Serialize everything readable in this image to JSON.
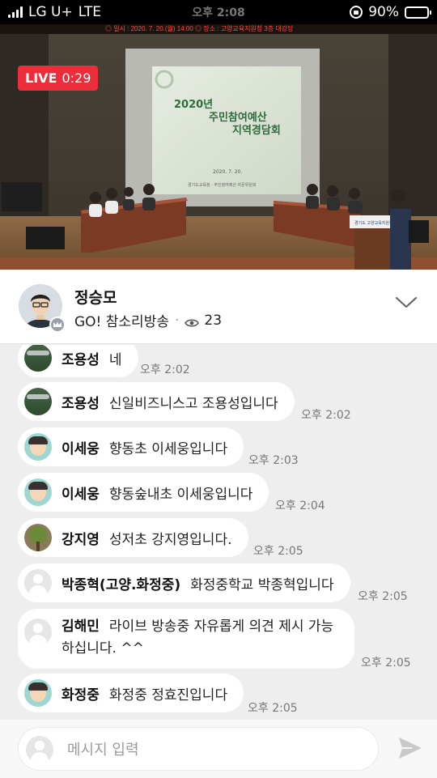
{
  "status_bar": {
    "carrier": "LG U+",
    "network": "LTE",
    "time": "오후 2:08",
    "battery": "90%",
    "battery_level": 0.9
  },
  "video": {
    "live_label": "LIVE",
    "elapsed": "0:29",
    "banner_text": "◎ 일시 : 2020. 7. 20.(월) 14:00   ◎ 장소 : 고양교육지원청 3층 대강당",
    "screen_title_1": "2020년",
    "screen_title_2": "주민참여예산",
    "screen_title_3": "지역경담회",
    "screen_date": "2020. 7. 20.",
    "screen_footer": "경기도교육청 · 주민참여예산 자문위원회",
    "podium_text": "경기도 고양교육지원청"
  },
  "profile": {
    "name": "정승모",
    "channel": "GO! 참소리방송",
    "separator": "·",
    "viewer_count": "23"
  },
  "messages": [
    {
      "name": "조용성",
      "text": "네",
      "time": "오후 2:02",
      "avatar": "ava-field"
    },
    {
      "name": "조용성",
      "text": "신일비즈니스고 조용성입니다",
      "time": "오후 2:02",
      "avatar": "ava-field"
    },
    {
      "name": "이세웅",
      "text": "향동초 이세웅입니다",
      "time": "오후 2:03",
      "avatar": "ava-kid"
    },
    {
      "name": "이세웅",
      "text": "향동숲내초 이세웅입니다",
      "time": "오후 2:04",
      "avatar": "ava-kid"
    },
    {
      "name": "강지영",
      "text": "성저초 강지영입니다.",
      "time": "오후 2:05",
      "avatar": "ava-tree"
    },
    {
      "name": "박종혁(고양.화정중)",
      "text": "화정중학교 박종혁입니다",
      "time": "오후 2:05",
      "avatar": "ava-default"
    },
    {
      "name": "김해민",
      "text": "라이브 방송중 자유롭게 의견 제시 가능하십니다. ^^",
      "time": "오후 2:05",
      "avatar": "ava-default"
    },
    {
      "name": "화정중",
      "text": "화정중 정효진입니다",
      "time": "오후 2:05",
      "avatar": "ava-kid"
    }
  ],
  "input": {
    "placeholder": "메시지 입력"
  },
  "colors": {
    "live_red": "#ee2d3a",
    "bubble": "#ffffff",
    "chat_bg": "#eeeeee"
  }
}
